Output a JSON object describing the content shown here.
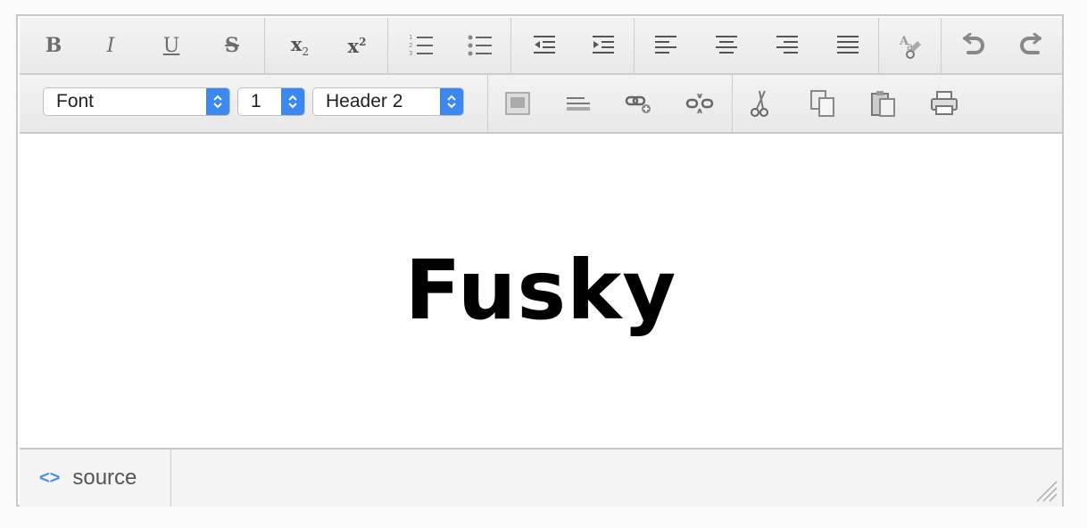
{
  "toolbar1": {
    "bold": "B",
    "italic": "I",
    "underline": "U",
    "strike": "S",
    "subscript_base": "x",
    "subscript_mark": "2",
    "superscript_base": "x",
    "superscript_mark": "2"
  },
  "toolbar2": {
    "font_select": "Font",
    "size_select": "1",
    "format_select": "Header 2"
  },
  "content": {
    "heading": "Fusky"
  },
  "footer": {
    "source_icon": "<>",
    "source_label": "source"
  },
  "colors": {
    "accent": "#3b88f3",
    "icon_gray": "#6d6d6d"
  }
}
